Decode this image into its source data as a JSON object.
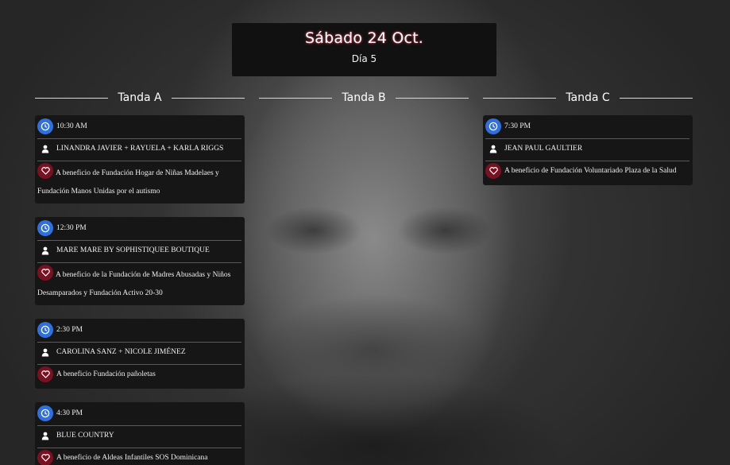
{
  "header": {
    "title": "Sábado 24 Oct.",
    "subtitle": "Día 5"
  },
  "columns": [
    {
      "label": "Tanda A",
      "events": [
        {
          "time": "10:30 AM",
          "designer": "LINANDRA JAVIER + RAYUELA + KARLA RIGGS",
          "benefit": "A beneficio de Fundación Hogar de Niñas Madelaes y Fundación Manos Unidas por el autismo"
        },
        {
          "time": "12:30 PM",
          "designer": "MARE MARE BY SOPHISTIQUEE BOUTIQUE",
          "benefit": "A beneficio de la Fundación de Madres Abusadas y Niños Desamparados y Fundación Activo 20-30"
        },
        {
          "time": "2:30 PM",
          "designer": "CAROLINA SANZ + NICOLE JIMÉNEZ",
          "benefit": "A beneficio Fundación pañoletas"
        },
        {
          "time": "4:30 PM",
          "designer": "BLUE COUNTRY",
          "benefit": "A beneficio de Aldeas Infantiles SOS Dominicana"
        }
      ]
    },
    {
      "label": "Tanda B",
      "events": []
    },
    {
      "label": "Tanda C",
      "events": [
        {
          "time": "7:30 PM",
          "designer": "JEAN PAUL GAULTIER",
          "benefit": "A beneficio de Fundación Voluntariado Plaza de la Salud"
        }
      ]
    }
  ],
  "icons": {
    "time": "clock-icon",
    "designer": "user-icon",
    "benefit": "heart-icon"
  },
  "colors": {
    "clock": "#2f6fe0",
    "heart": "#7a1020",
    "title_glow": "#e34b5c"
  }
}
